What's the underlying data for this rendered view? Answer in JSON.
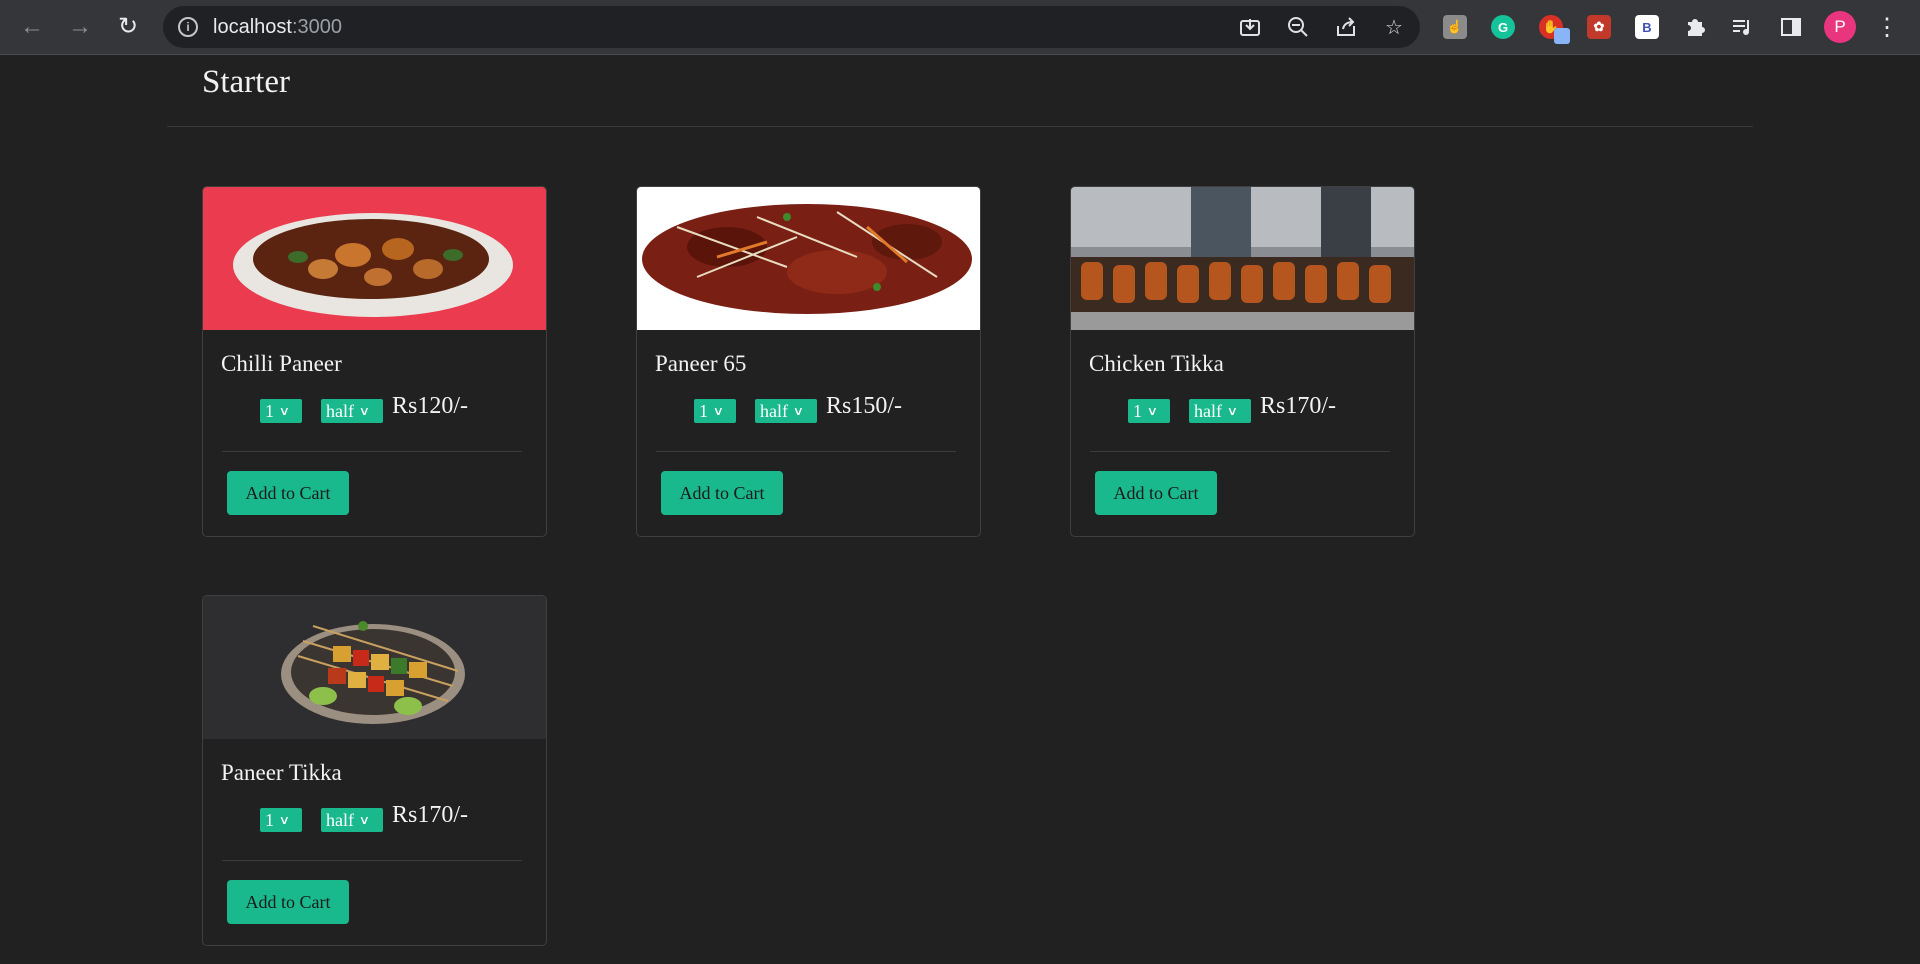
{
  "browser": {
    "url_host": "localhost",
    "url_port": ":3000",
    "profile_initial": "P",
    "ext_b_label": "B"
  },
  "page": {
    "section_title": "Starter"
  },
  "cards": [
    {
      "title": "Chilli Paneer",
      "qty": "1",
      "size": "half",
      "price": "Rs120/-",
      "button": "Add to Cart"
    },
    {
      "title": "Paneer 65",
      "qty": "1",
      "size": "half",
      "price": "Rs150/-",
      "button": "Add to Cart"
    },
    {
      "title": "Chicken Tikka",
      "qty": "1",
      "size": "half",
      "price": "Rs170/-",
      "button": "Add to Cart"
    },
    {
      "title": "Paneer Tikka",
      "qty": "1",
      "size": "half",
      "price": "Rs170/-",
      "button": "Add to Cart"
    }
  ],
  "colors": {
    "accent": "#1ab98d",
    "background": "#212121"
  }
}
